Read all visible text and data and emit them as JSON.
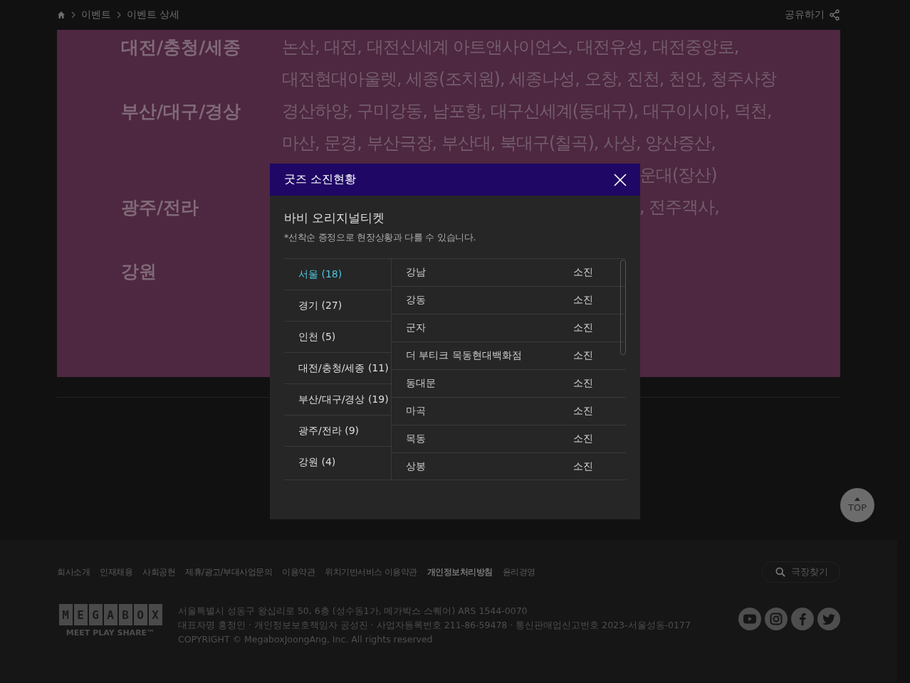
{
  "breadcrumb": {
    "items": [
      "이벤트",
      "이벤트 상세"
    ],
    "share": "공유하기"
  },
  "regions": [
    {
      "label": "대전/충청/세종",
      "lines": [
        {
          "kind": "full",
          "text": "논산, 대전, 대전신세계 아트앤사이언스, 대전유성, 대전중앙로,"
        },
        {
          "kind": "full",
          "text": "대전현대아울렛, 세종(조치원), 세종나성, 오창, 진천, 천안, 청주사창"
        }
      ]
    },
    {
      "label": "부산/대구/경상",
      "lines": [
        {
          "kind": "full",
          "text": "경산하양, 구미강동, 남포항, 대구신세계(동대구), 대구이시아, 덕천,"
        },
        {
          "kind": "full",
          "text": "마산, 문경, 부산극장, 부산대, 북대구(칠곡), 사상, 양산증산,"
        },
        {
          "kind": "cut",
          "text": "운대(장산)"
        }
      ]
    },
    {
      "label": "광주/전라",
      "lines": [
        {
          "kind": "cut",
          "text": ", 전주객사,"
        },
        {
          "kind": "hidden"
        }
      ]
    },
    {
      "label": "강원",
      "lines": [
        {
          "kind": "hidden"
        }
      ]
    }
  ],
  "top_button": "TOP",
  "dialog": {
    "title": "굿즈 소진현황",
    "product": "바비 오리지널티켓",
    "note": "*선착순 증정으로 현장상황과 다를 수 있습니다.",
    "areas": [
      {
        "label": "서울 (18)",
        "selected": true
      },
      {
        "label": "경기 (27)",
        "selected": false
      },
      {
        "label": "인천 (5)",
        "selected": false
      },
      {
        "label": "대전/충청/세종 (11)",
        "selected": false
      },
      {
        "label": "부산/대구/경상 (19)",
        "selected": false
      },
      {
        "label": "광주/전라 (9)",
        "selected": false
      },
      {
        "label": "강원 (4)",
        "selected": false
      }
    ],
    "theaters": [
      {
        "name": "강남",
        "status": "소진"
      },
      {
        "name": "강동",
        "status": "소진"
      },
      {
        "name": "군자",
        "status": "소진"
      },
      {
        "name": "더 부티크 목동현대백화점",
        "status": "소진"
      },
      {
        "name": "동대문",
        "status": "소진"
      },
      {
        "name": "마곡",
        "status": "소진"
      },
      {
        "name": "목동",
        "status": "소진"
      },
      {
        "name": "상봉",
        "status": "소진"
      }
    ]
  },
  "footer": {
    "links": [
      {
        "label": "회사소개",
        "bold": false
      },
      {
        "label": "인재채용",
        "bold": false
      },
      {
        "label": "사회공헌",
        "bold": false
      },
      {
        "label": "제휴/광고/부대사업문의",
        "bold": false
      },
      {
        "label": "이용약관",
        "bold": false
      },
      {
        "label": "위치기반서비스 이용약관",
        "bold": false
      },
      {
        "label": "개인정보처리방침",
        "bold": true
      },
      {
        "label": "윤리경영",
        "bold": false
      }
    ],
    "search": "극장찾기",
    "logo": {
      "letters": [
        "M",
        "E",
        "G",
        "A",
        "B",
        "O",
        "X"
      ],
      "tagline": "MEET PLAY SHARE™"
    },
    "info": [
      "서울특별시 성동구 왕십리로 50, 6층 (성수동1가, 메가박스 스퀘어) ARS 1544-0070",
      "대표자명 홍정인 · 개인정보보호책임자 공성진 · 사업자등록번호 211-86-59478 · 통신판매업신고번호 2023-서울성동-0177",
      "COPYRIGHT © MegaboxJoongAng, Inc. All rights reserved"
    ]
  }
}
